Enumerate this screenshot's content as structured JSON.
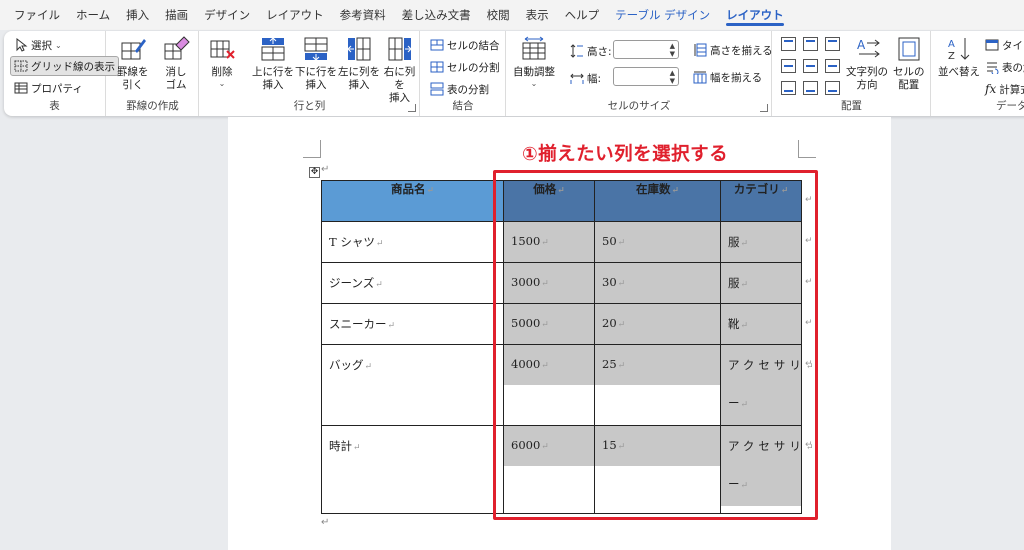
{
  "tabs": [
    "ファイル",
    "ホーム",
    "挿入",
    "描画",
    "デザイン",
    "レイアウト",
    "参考資料",
    "差し込み文書",
    "校閲",
    "表示",
    "ヘルプ",
    "テーブル デザイン",
    "レイアウト"
  ],
  "active_tab_index": 12,
  "contextual_tab_indices": [
    11,
    12
  ],
  "groups": {
    "table": {
      "label": "表",
      "select": "選択",
      "gridlines": "グリッド線の表示",
      "properties": "プロパティ"
    },
    "draw_borders": {
      "label": "罫線の作成",
      "draw_table_1": "罫線を",
      "draw_table_2": "引く",
      "eraser_1": "消し",
      "eraser_2": "ゴム"
    },
    "rows_cols": {
      "label": "行と列",
      "delete": "削除",
      "insert_above_1": "上に行を",
      "insert_above_2": "挿入",
      "insert_below_1": "下に行を",
      "insert_below_2": "挿入",
      "insert_left_1": "左に列を",
      "insert_left_2": "挿入",
      "insert_right_1": "右に列を",
      "insert_right_2": "挿入"
    },
    "merge": {
      "label": "結合",
      "merge_cells": "セルの結合",
      "split_cells": "セルの分割",
      "split_table": "表の分割"
    },
    "cell_size": {
      "label": "セルのサイズ",
      "autofit": "自動調整",
      "height_label": "高さ:",
      "width_label": "幅:",
      "height_value": "",
      "width_value": "",
      "distribute_rows": "高さを揃える",
      "distribute_cols": "幅を揃える"
    },
    "alignment": {
      "label": "配置",
      "text_direction_1": "文字列の",
      "text_direction_2": "方向",
      "cell_margins_1": "セルの",
      "cell_margins_2": "配置"
    },
    "data": {
      "label": "データ",
      "sort": "並べ替え",
      "repeat_header": "タイトル",
      "convert": "表の解",
      "formula": "計算式"
    }
  },
  "callout": "①揃えたい列を選択する",
  "table": {
    "headers": [
      "商品名",
      "価格",
      "在庫数",
      "カテゴリ"
    ],
    "rows": [
      [
        "T シャツ",
        "1500",
        "50",
        "服"
      ],
      [
        "ジーンズ",
        "3000",
        "30",
        "服"
      ],
      [
        "スニーカー",
        "5000",
        "20",
        "靴"
      ],
      [
        "バッグ",
        "4000",
        "25",
        "アクセサリ"
      ],
      [
        "時計",
        "6000",
        "15",
        "アクセサリ"
      ]
    ],
    "row_tail": [
      "",
      "",
      "",
      "",
      "ー",
      "ー"
    ],
    "selected_columns": [
      1,
      2,
      3
    ]
  },
  "colors": {
    "accent": "#2b62c5",
    "header_fill": "#5b9bd5",
    "header_selected": "#4a74a6",
    "selection": "#c8c8c8",
    "callout": "#e0202d"
  },
  "pilcrow": "↵"
}
